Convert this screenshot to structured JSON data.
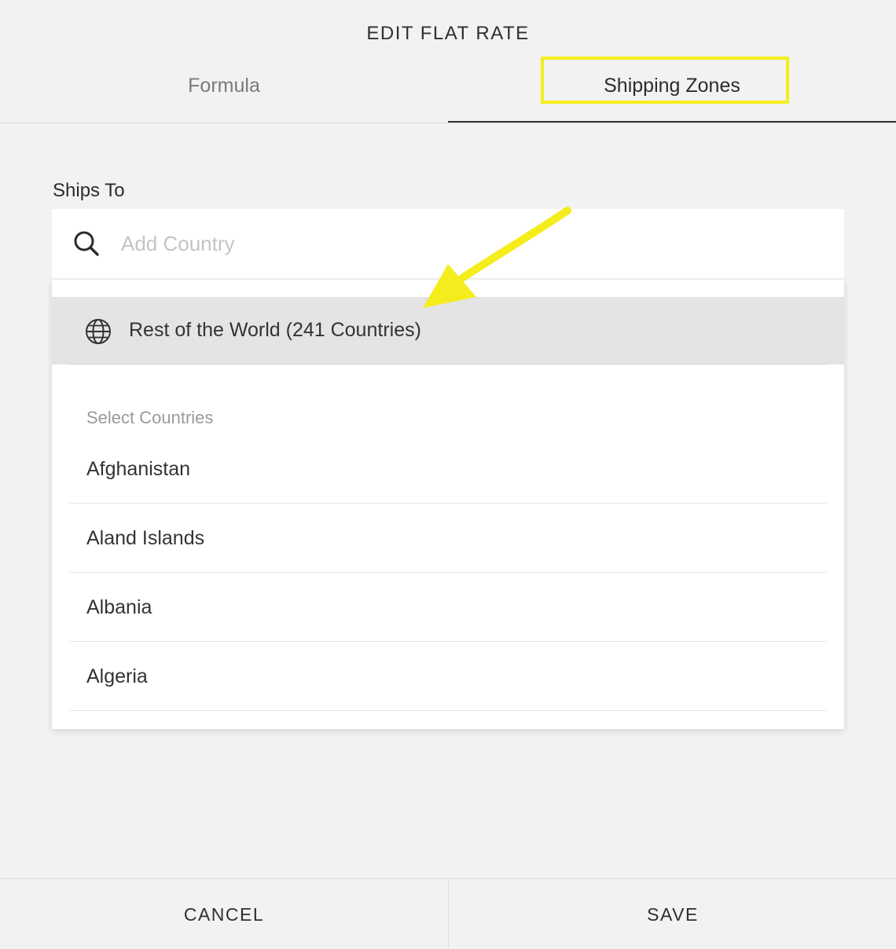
{
  "dialog": {
    "title": "EDIT FLAT RATE"
  },
  "tabs": [
    {
      "label": "Formula",
      "active": false
    },
    {
      "label": "Shipping Zones",
      "active": true
    }
  ],
  "ships_to": {
    "label": "Ships To",
    "search_placeholder": "Add Country",
    "search_value": ""
  },
  "dropdown": {
    "rest_of_world": {
      "label": "Rest of the World (241 Countries)",
      "icon": "globe-icon"
    },
    "section_heading": "Select Countries",
    "countries": [
      "Afghanistan",
      "Aland Islands",
      "Albania",
      "Algeria"
    ]
  },
  "footer": {
    "cancel_label": "CANCEL",
    "save_label": "SAVE"
  },
  "colors": {
    "highlight": "#f5ec1d",
    "panel_background": "#f2f2f2",
    "selected_row": "#e4e4e4"
  }
}
